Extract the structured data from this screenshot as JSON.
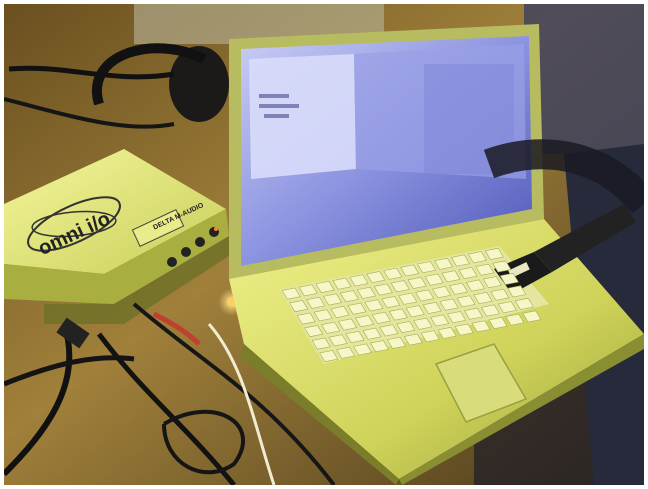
{
  "photo": {
    "interface_brand": "omni i/o",
    "interface_maker": "DELTA M-AUDIO"
  },
  "colors": {
    "table_wood": "#8a6a2a",
    "laptop_silver": "#d8dc6a",
    "screen_blue": "#5a63c8",
    "interface_yellow": "#e6ee7a",
    "cable_black": "#141414"
  }
}
